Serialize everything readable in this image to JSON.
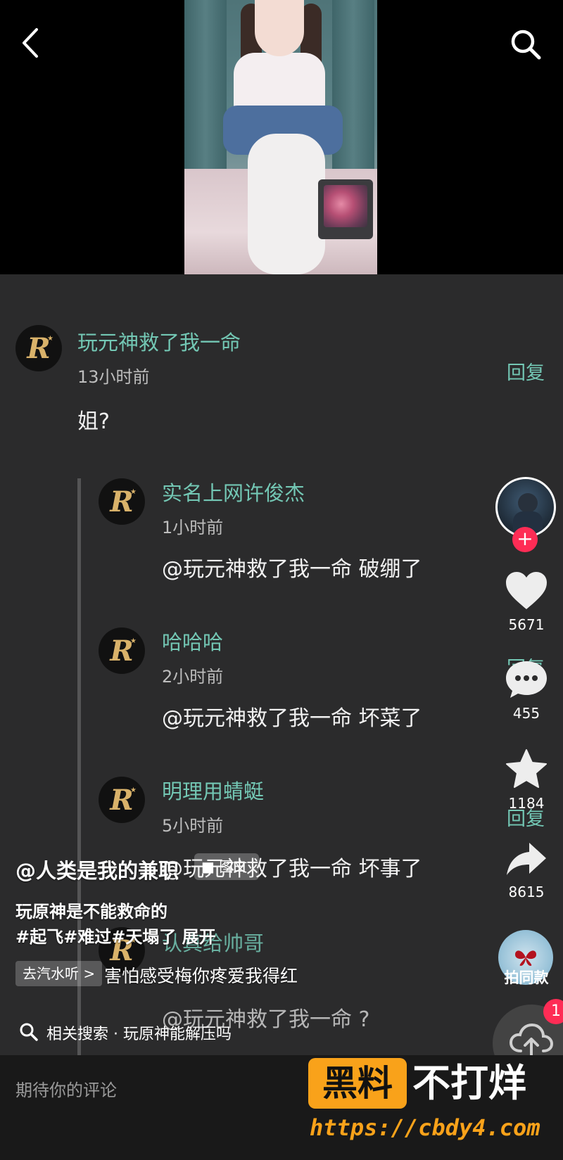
{
  "comments": [
    {
      "username": "玩元神救了我一命",
      "time": "13小时前",
      "text": "姐?",
      "reply_label": "回复",
      "replies": [
        {
          "username": "实名上网许俊杰",
          "time": "1小时前",
          "text": "@玩元神救了我一命 破绷了"
        },
        {
          "username": "哈哈哈",
          "time": "2小时前",
          "text": "@玩元神救了我一命 坏菜了"
        },
        {
          "username": "明理用蜻蜓",
          "time": "5小时前",
          "text": "@玩元神救了我一命 坏事了"
        },
        {
          "username": "认真给帅哥",
          "text": "@玩元神救了我一命 ?"
        }
      ]
    }
  ],
  "reply_labels": {
    "mid": "回复",
    "lower": "回复"
  },
  "actions": {
    "likes": "5671",
    "comments": "455",
    "favorites": "1184",
    "shares": "8615",
    "same_style_label": "拍同款"
  },
  "follow_icon": "+",
  "upload_badge": "1",
  "caption": {
    "author": "@人类是我的兼职",
    "tag": "■ 图文",
    "line1": "玩原神是不能救命的",
    "line2": "#起飞#难过#天塌了 展开",
    "music_chip": "去汽水听 >",
    "music_title": "害怕感受梅你疼爱我得红"
  },
  "related_search": "相关搜索 · 玩原神能解压吗",
  "input": {
    "placeholder": "期待你的评论"
  },
  "watermark": {
    "box": "黑料",
    "text": "不打烊",
    "url": "https://cbdy4.com"
  },
  "colors": {
    "accent": "#73c7b4",
    "brand_red": "#fe2c55",
    "watermark_orange": "#f9a21a",
    "sheet_bg": "#2b2b2c"
  },
  "icons": [
    "back-arrow-icon",
    "search-icon",
    "heart-icon",
    "comment-bubble-icon",
    "star-icon",
    "share-arrow-icon",
    "upload-icon",
    "search-small-icon",
    "butterfly-icon"
  ]
}
